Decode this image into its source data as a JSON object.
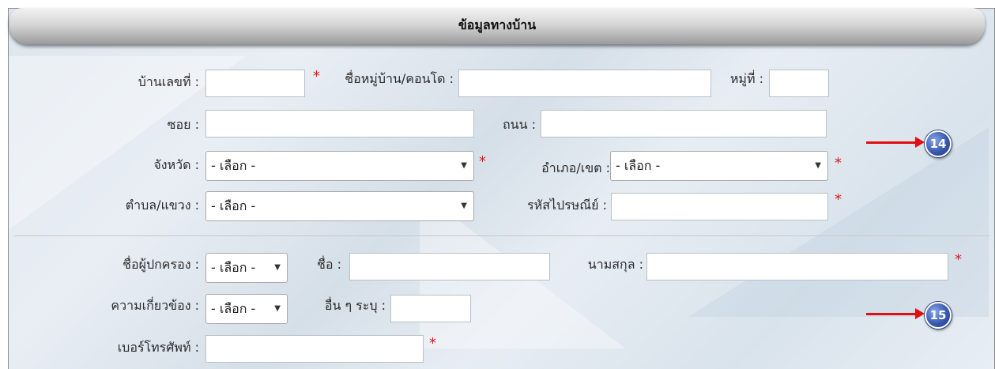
{
  "section": {
    "title": "ข้อมูลทางบ้าน"
  },
  "address": {
    "house_no_label": "บ้านเลขที่ :",
    "village_label": "ชื่อหมู่บ้าน/คอนโด :",
    "moo_label": "หมู่ที่ :",
    "soi_label": "ซอย :",
    "road_label": "ถนน :",
    "province_label": "จังหวัด :",
    "province_value": "- เลือก -",
    "district_label": "อำเภอ/เขต :",
    "district_value": "- เลือก -",
    "subdistrict_label": "ตำบล/แขวง :",
    "subdistrict_value": "- เลือก -",
    "postcode_label": "รหัสไปรษณีย์ :"
  },
  "guardian": {
    "title_label": "ชื่อผู้ปกครอง :",
    "title_value": "- เลือก -",
    "first_name_label": "ชื่อ :",
    "last_name_label": "นามสกุล :",
    "relation_label": "ความเกี่ยวข้อง :",
    "relation_value": "- เลือก -",
    "other_label": "อื่น ๆ ระบุ :",
    "phone_label": "เบอร์โทรศัพท์ :"
  },
  "required_mark": "*",
  "dropdown_caret": "▼",
  "annotations": {
    "marker_14": "14",
    "marker_15": "15"
  },
  "colors": {
    "required": "#e01818",
    "arrow": "#e01010",
    "badge": "#3859b0"
  }
}
